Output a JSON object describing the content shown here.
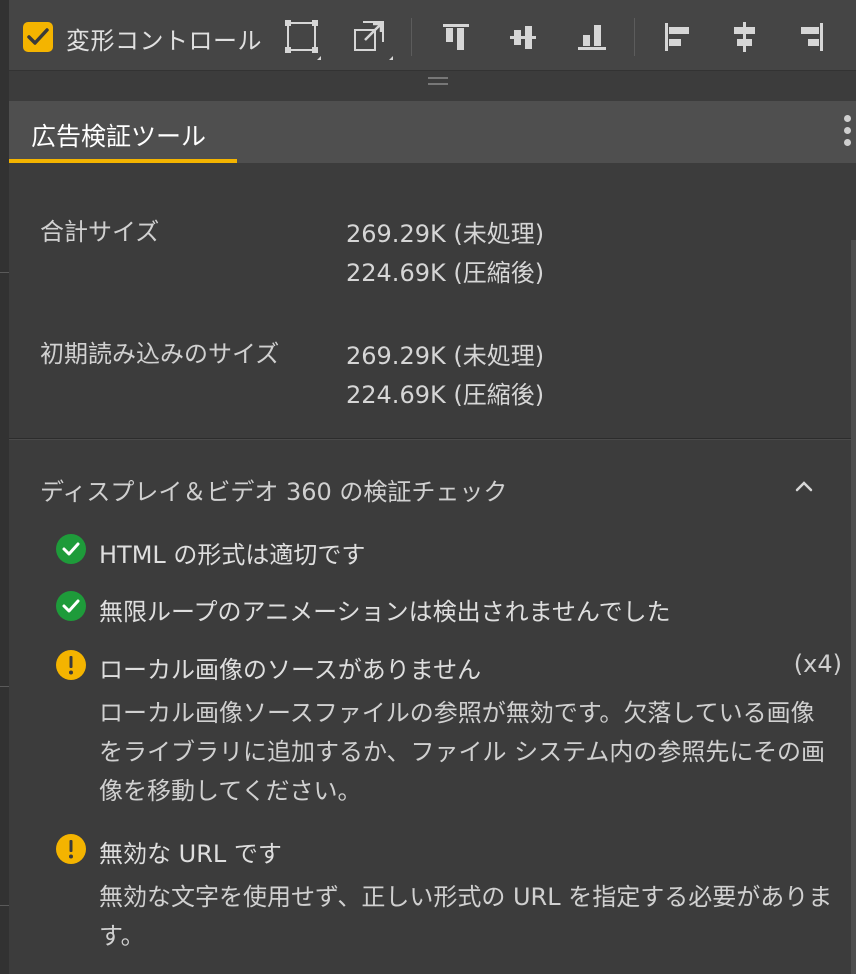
{
  "toolbar": {
    "transform_control_label": "変形コントロール"
  },
  "panel": {
    "tab_title": "広告検証ツール"
  },
  "sizes": {
    "total_label": "合計サイズ",
    "total_raw": "269.29K (未処理)",
    "total_compressed": "224.69K (圧縮後)",
    "initial_label": "初期読み込みのサイズ",
    "initial_raw": "269.29K (未処理)",
    "initial_compressed": "224.69K (圧縮後)"
  },
  "checks": {
    "section_title": "ディスプレイ＆ビデオ 360 の検証チェック",
    "items": [
      {
        "status": "ok",
        "text": "HTML の形式は適切です"
      },
      {
        "status": "ok",
        "text": "無限ループのアニメーションは検出されませんでした"
      },
      {
        "status": "warning",
        "text": "ローカル画像のソースがありません",
        "count": "(x4)",
        "description": "ローカル画像ソースファイルの参照が無効です。欠落している画像をライブラリに追加するか、ファイル システム内の参照先にその画像を移動してください。"
      },
      {
        "status": "warning",
        "text": "無効な URL です",
        "description": "無効な文字を使用せず、正しい形式の URL を指定する必要があります。"
      }
    ]
  },
  "colors": {
    "accent": "#f4b400",
    "ok": "#1e9b3a",
    "background": "#3c3c3c"
  },
  "icons": [
    "checkbox-checked-icon",
    "free-transform-icon",
    "scale-icon",
    "align-top-icon",
    "align-vertical-center-icon",
    "align-bottom-icon",
    "align-left-icon",
    "align-horizontal-center-icon",
    "align-right-icon",
    "drag-handle-icon",
    "kebab-menu-icon",
    "chevron-up-icon",
    "success-check-icon",
    "warning-icon"
  ]
}
